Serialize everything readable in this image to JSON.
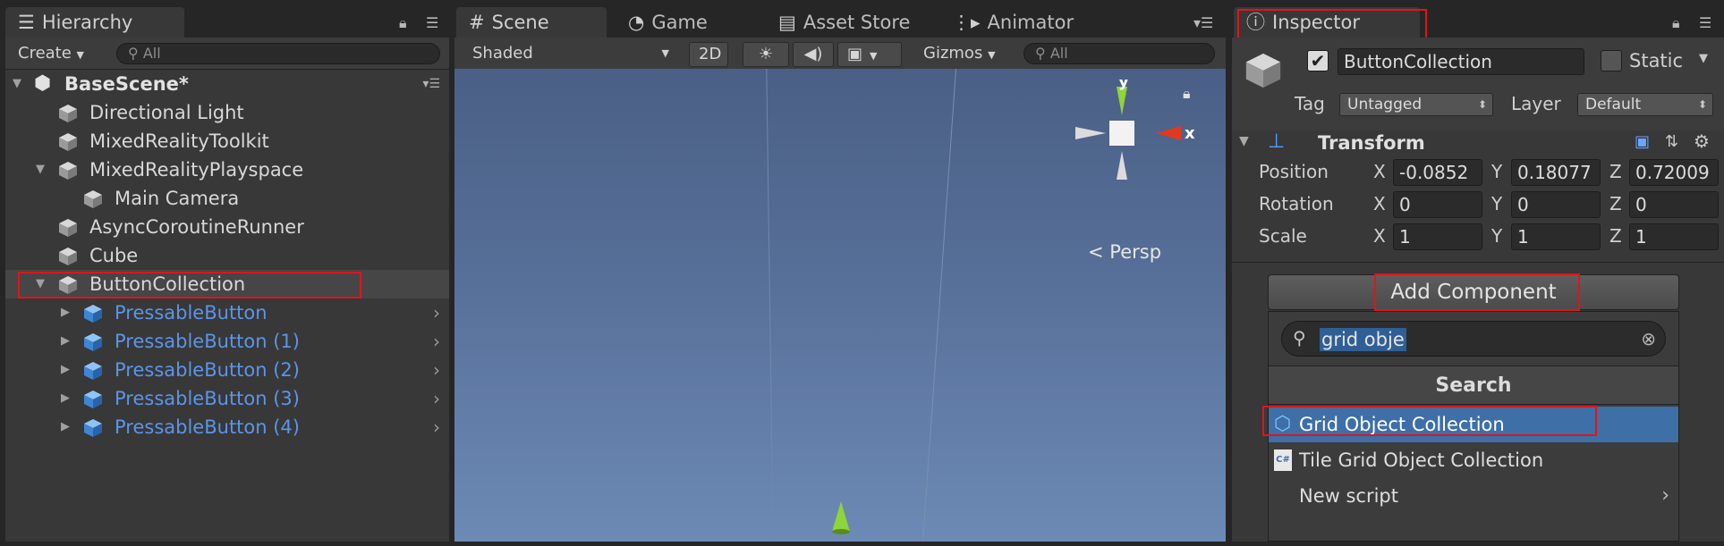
{
  "hierarchy": {
    "tab_label": "Hierarchy",
    "create_label": "Create",
    "search_placeholder": "All",
    "scene_name": "BaseScene*",
    "items": [
      {
        "label": "Directional Light"
      },
      {
        "label": "MixedRealityToolkit"
      },
      {
        "label": "MixedRealityPlayspace"
      },
      {
        "label": "Main Camera"
      },
      {
        "label": "AsyncCoroutineRunner"
      },
      {
        "label": "Cube"
      },
      {
        "label": "ButtonCollection"
      },
      {
        "label": "PressableButton"
      },
      {
        "label": "PressableButton (1)"
      },
      {
        "label": "PressableButton (2)"
      },
      {
        "label": "PressableButton (3)"
      },
      {
        "label": "PressableButton (4)"
      }
    ]
  },
  "scene": {
    "tabs": [
      {
        "label": "Scene"
      },
      {
        "label": "Game"
      },
      {
        "label": "Asset Store"
      },
      {
        "label": "Animator"
      }
    ],
    "shading_mode": "Shaded",
    "mode_2d": "2D",
    "gizmos_label": "Gizmos",
    "search_placeholder": "All",
    "projection_label": "Persp",
    "gizmo_axes": {
      "y": "y",
      "x": "x"
    }
  },
  "inspector": {
    "tab_label": "Inspector",
    "object_name": "ButtonCollection",
    "active_checked": true,
    "static_label": "Static",
    "tag_label": "Tag",
    "tag_value": "Untagged",
    "layer_label": "Layer",
    "layer_value": "Default",
    "transform": {
      "title": "Transform",
      "rows": [
        {
          "label": "Position",
          "x": "-0.0852",
          "y": "0.18077",
          "z": "0.72009"
        },
        {
          "label": "Rotation",
          "x": "0",
          "y": "0",
          "z": "0"
        },
        {
          "label": "Scale",
          "x": "1",
          "y": "1",
          "z": "1"
        }
      ]
    },
    "add_component_label": "Add Component",
    "popup": {
      "search_text": "grid obje",
      "header": "Search",
      "results": [
        {
          "label": "Grid Object Collection"
        },
        {
          "label": "Tile Grid Object Collection"
        },
        {
          "label": "New script"
        }
      ]
    }
  },
  "colors": {
    "highlight_box": "#e0141c",
    "selection_blue": "#3e6fa6",
    "prefab_text": "#5b95e8",
    "axis_x": "#e03a1c",
    "axis_y": "#8fd43a"
  }
}
